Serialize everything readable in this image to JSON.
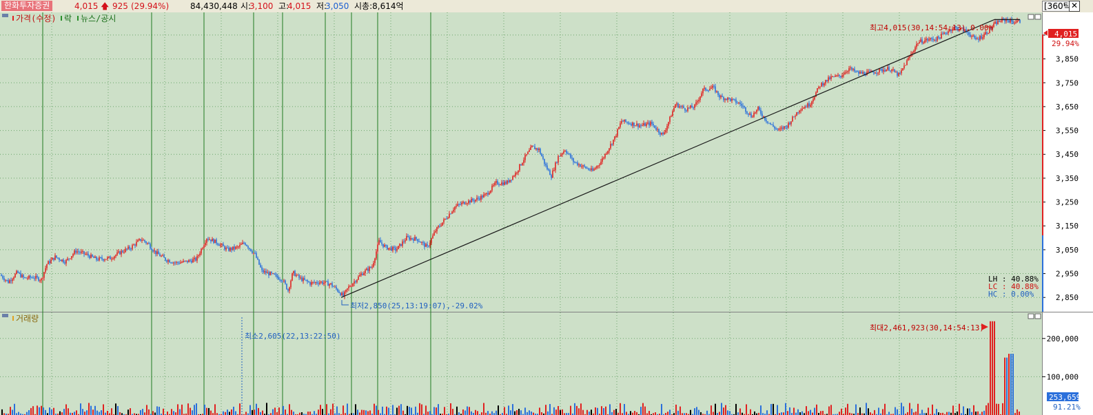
{
  "header": {
    "stock_name": "한화투자증권",
    "price": "4,015",
    "arrow": "🡅",
    "change": "925",
    "change_rate": "(29.94%)",
    "volume_total": "84,430,448",
    "open_label": "시:",
    "open_value": "3,100",
    "high_label": "고:",
    "high_value": "4,015",
    "low_label": "저:",
    "low_value": "3,050",
    "market_cap": "시총:8,614억",
    "period_button": "[360틱]",
    "close_button": "✕"
  },
  "price_panel": {
    "legend_price": "가격(수정)",
    "legend_lock": "락",
    "legend_news": "뉴스/공시",
    "high_annotation": "최고4,015(30,14:54:13),0.00%",
    "low_annotation": "최저2,850(25,13:19:07),-29.02%",
    "lh_label": "LH :  40.88%",
    "lc_label": "LC :  40.88%",
    "hc_label": "HC :   0.00%",
    "current_price_tag": "4,015",
    "current_rate_tag": "29.94%"
  },
  "volume_panel": {
    "legend": "거래량",
    "max_annotation": "최대2,461,923(30,14:54:13)",
    "min_annotation": "최소2,605(22,13:22:50)",
    "current_volume_tag": "253,659",
    "current_rate_tag": "91.21%"
  },
  "colors": {
    "background": "#cde0c8",
    "grid": "#3c8a3c",
    "up": "#e02020",
    "down": "#2a6fdb",
    "axis": "#000000",
    "annotation": "#c00000",
    "low_annotation": "#2060c0"
  },
  "chart_data": [
    {
      "type": "candlestick",
      "title": "가격(수정)",
      "x_label": "",
      "y_label": "",
      "y_axis_ticks": [
        2850,
        2950,
        3050,
        3150,
        3250,
        3350,
        3450,
        3550,
        3650,
        3750,
        3850,
        3950
      ],
      "y_axis_tick_labels": [
        "2,850",
        "2,950",
        "3,050",
        "3,150",
        "3,250",
        "3,350",
        "3,450",
        "3,550",
        "3,650",
        "3,750",
        "3,850",
        "3,950"
      ],
      "ylim": [
        2790,
        4045
      ],
      "grid": true,
      "high": 4015,
      "low": 2850,
      "series_path_anchors": [
        [
          0,
          2945
        ],
        [
          12,
          2915
        ],
        [
          25,
          2955
        ],
        [
          35,
          2930
        ],
        [
          48,
          2935
        ],
        [
          60,
          2925
        ],
        [
          68,
          2990
        ],
        [
          80,
          3020
        ],
        [
          95,
          3000
        ],
        [
          110,
          3045
        ],
        [
          125,
          3030
        ],
        [
          140,
          3010
        ],
        [
          160,
          3015
        ],
        [
          175,
          3040
        ],
        [
          190,
          3060
        ],
        [
          205,
          3095
        ],
        [
          215,
          3075
        ],
        [
          225,
          3040
        ],
        [
          240,
          3010
        ],
        [
          255,
          2995
        ],
        [
          270,
          3000
        ],
        [
          285,
          3010
        ],
        [
          300,
          3100
        ],
        [
          315,
          3080
        ],
        [
          330,
          3050
        ],
        [
          345,
          3060
        ],
        [
          355,
          3080
        ],
        [
          370,
          3030
        ],
        [
          380,
          2960
        ],
        [
          395,
          2945
        ],
        [
          410,
          2925
        ],
        [
          418,
          2880
        ],
        [
          425,
          2955
        ],
        [
          435,
          2930
        ],
        [
          450,
          2910
        ],
        [
          465,
          2915
        ],
        [
          480,
          2905
        ],
        [
          490,
          2880
        ],
        [
          498,
          2855
        ],
        [
          505,
          2890
        ],
        [
          515,
          2920
        ],
        [
          525,
          2950
        ],
        [
          540,
          2980
        ],
        [
          550,
          3085
        ],
        [
          560,
          3060
        ],
        [
          575,
          3050
        ],
        [
          590,
          3100
        ],
        [
          605,
          3095
        ],
        [
          620,
          3060
        ],
        [
          632,
          3130
        ],
        [
          645,
          3175
        ],
        [
          660,
          3230
        ],
        [
          675,
          3250
        ],
        [
          690,
          3260
        ],
        [
          705,
          3280
        ],
        [
          720,
          3330
        ],
        [
          735,
          3330
        ],
        [
          748,
          3370
        ],
        [
          760,
          3430
        ],
        [
          772,
          3480
        ],
        [
          782,
          3470
        ],
        [
          792,
          3400
        ],
        [
          800,
          3360
        ],
        [
          810,
          3440
        ],
        [
          820,
          3470
        ],
        [
          832,
          3420
        ],
        [
          845,
          3400
        ],
        [
          860,
          3380
        ],
        [
          872,
          3420
        ],
        [
          880,
          3460
        ],
        [
          892,
          3520
        ],
        [
          902,
          3590
        ],
        [
          915,
          3580
        ],
        [
          930,
          3570
        ],
        [
          945,
          3580
        ],
        [
          955,
          3550
        ],
        [
          962,
          3530
        ],
        [
          972,
          3600
        ],
        [
          980,
          3660
        ],
        [
          995,
          3640
        ],
        [
          1008,
          3650
        ],
        [
          1020,
          3720
        ],
        [
          1035,
          3730
        ],
        [
          1045,
          3690
        ],
        [
          1060,
          3680
        ],
        [
          1075,
          3660
        ],
        [
          1090,
          3610
        ],
        [
          1100,
          3640
        ],
        [
          1110,
          3600
        ],
        [
          1120,
          3570
        ],
        [
          1130,
          3550
        ],
        [
          1142,
          3570
        ],
        [
          1150,
          3600
        ],
        [
          1160,
          3640
        ],
        [
          1175,
          3660
        ],
        [
          1190,
          3740
        ],
        [
          1205,
          3770
        ],
        [
          1220,
          3780
        ],
        [
          1232,
          3810
        ],
        [
          1245,
          3790
        ],
        [
          1260,
          3790
        ],
        [
          1275,
          3800
        ],
        [
          1290,
          3810
        ],
        [
          1305,
          3780
        ],
        [
          1312,
          3820
        ],
        [
          1322,
          3870
        ],
        [
          1332,
          3920
        ],
        [
          1345,
          3930
        ],
        [
          1360,
          3935
        ],
        [
          1372,
          3960
        ],
        [
          1382,
          3980
        ],
        [
          1395,
          3975
        ],
        [
          1405,
          3960
        ],
        [
          1415,
          3930
        ],
        [
          1425,
          3945
        ],
        [
          1435,
          3970
        ],
        [
          1445,
          4000
        ],
        [
          1452,
          4010
        ],
        [
          1460,
          4015
        ],
        [
          1470,
          4005
        ],
        [
          1480,
          4008
        ]
      ],
      "trend_line": {
        "from": [
          495,
          2850
        ],
        "to": [
          1443,
          4015
        ]
      }
    },
    {
      "type": "bar",
      "title": "거래량",
      "y_axis_ticks": [
        100000,
        200000
      ],
      "y_axis_tick_labels": [
        "100,000",
        "200,000"
      ],
      "ylim": [
        0,
        250000
      ],
      "max": 2461923,
      "min": 2605,
      "grid": true
    }
  ]
}
